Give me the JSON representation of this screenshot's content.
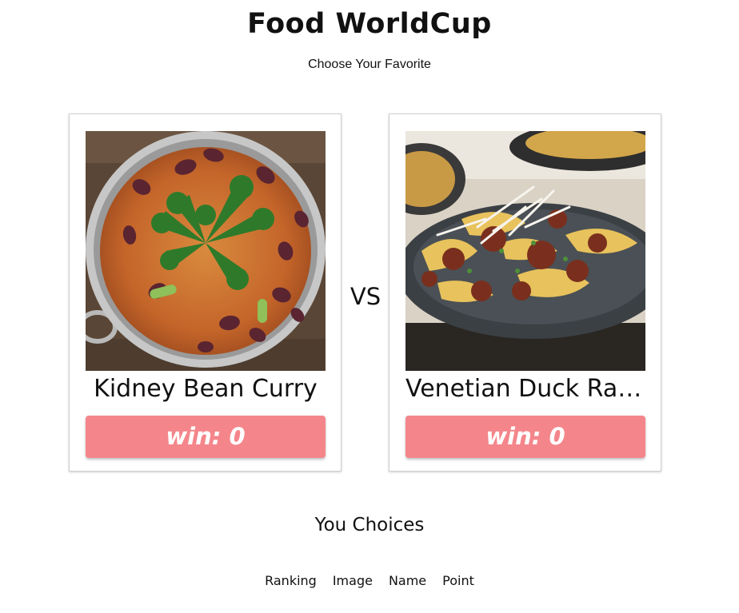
{
  "header": {
    "title": "Food WorldCup",
    "subtitle": "Choose Your Favorite"
  },
  "match": {
    "vs_label": "VS",
    "left": {
      "name": "Kidney Bean Curry",
      "win_label": "win: 0",
      "image": "kidney-bean-curry-photo"
    },
    "right": {
      "name": "Venetian Duck Ragu",
      "win_label": "win: 0",
      "image": "venetian-duck-ragu-photo"
    }
  },
  "choices": {
    "heading": "You Choices",
    "columns": [
      "Ranking",
      "Image",
      "Name",
      "Point"
    ]
  },
  "colors": {
    "win_button": "#f4868b",
    "text": "#111111",
    "card_border": "#cfcfcf"
  }
}
